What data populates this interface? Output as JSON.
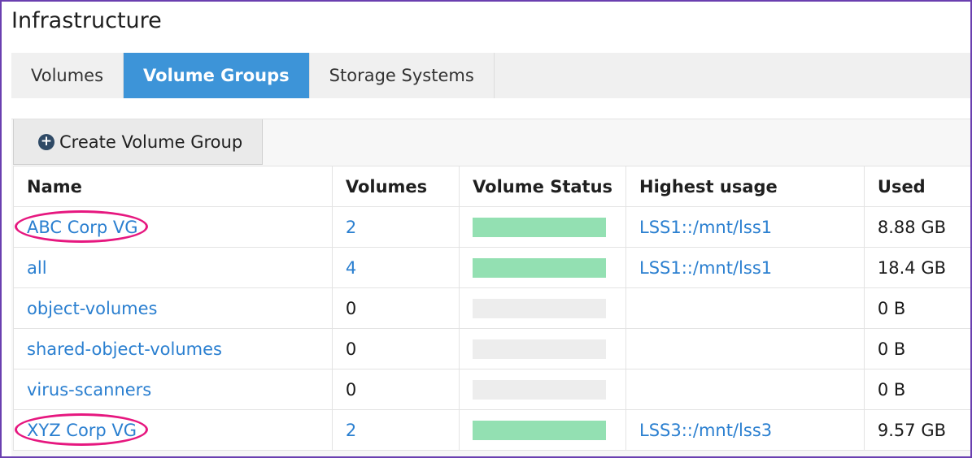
{
  "page": {
    "title": "Infrastructure"
  },
  "tabs": [
    {
      "label": "Volumes",
      "active": false
    },
    {
      "label": "Volume Groups",
      "active": true
    },
    {
      "label": "Storage Systems",
      "active": false
    }
  ],
  "toolbar": {
    "create_label": "Create Volume Group",
    "create_icon": "plus-circle-icon"
  },
  "table": {
    "headers": [
      "Name",
      "Volumes",
      "Volume Status",
      "Highest usage",
      "Used"
    ],
    "rows": [
      {
        "name": "ABC Corp VG",
        "volumes": "2",
        "volumes_link": true,
        "status_fill": 1.0,
        "highest_usage": "LSS1::/mnt/lss1",
        "used": "8.88 GB",
        "highlighted": true
      },
      {
        "name": "all",
        "volumes": "4",
        "volumes_link": true,
        "status_fill": 1.0,
        "highest_usage": "LSS1::/mnt/lss1",
        "used": "18.4 GB",
        "highlighted": false
      },
      {
        "name": "object-volumes",
        "volumes": "0",
        "volumes_link": false,
        "status_fill": 0,
        "highest_usage": "",
        "used": "0 B",
        "highlighted": false
      },
      {
        "name": "shared-object-volumes",
        "volumes": "0",
        "volumes_link": false,
        "status_fill": 0,
        "highest_usage": "",
        "used": "0 B",
        "highlighted": false
      },
      {
        "name": "virus-scanners",
        "volumes": "0",
        "volumes_link": false,
        "status_fill": 0,
        "highest_usage": "",
        "used": "0 B",
        "highlighted": false
      },
      {
        "name": "XYZ Corp VG",
        "volumes": "2",
        "volumes_link": true,
        "status_fill": 1.0,
        "highest_usage": "LSS3::/mnt/lss3",
        "used": "9.57 GB",
        "highlighted": true
      }
    ]
  },
  "colors": {
    "accent": "#3d94d8",
    "link": "#2a7fd0",
    "status_ok": "#93e0b2",
    "status_empty": "#ededed",
    "highlight": "#e6177f",
    "frame": "#6a3fb0"
  }
}
